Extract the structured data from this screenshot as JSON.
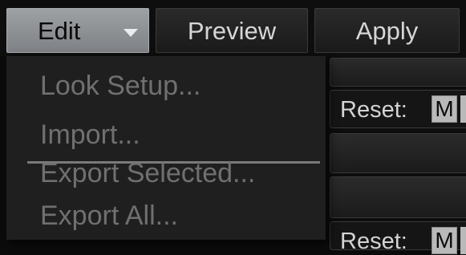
{
  "toolbar": {
    "edit_label": "Edit",
    "preview_label": "Preview",
    "apply_label": "Apply"
  },
  "edit_menu": {
    "items": [
      {
        "label": "Look Setup...",
        "enabled": false
      },
      {
        "label": "Import...",
        "enabled": false
      },
      {
        "label": "Export Selected...",
        "enabled": false
      },
      {
        "label": "Export All...",
        "enabled": false
      }
    ]
  },
  "right_panel": {
    "reset_label": "Reset:",
    "m_label": "M"
  },
  "colors": {
    "background": "#0b0b0b",
    "menu_background": "#1f1f1f",
    "disabled_text": "#707070",
    "active_button": "#8e9195",
    "button_text": "#d6d6d6"
  },
  "icons": {
    "edit_dropdown": "caret-down-icon"
  }
}
